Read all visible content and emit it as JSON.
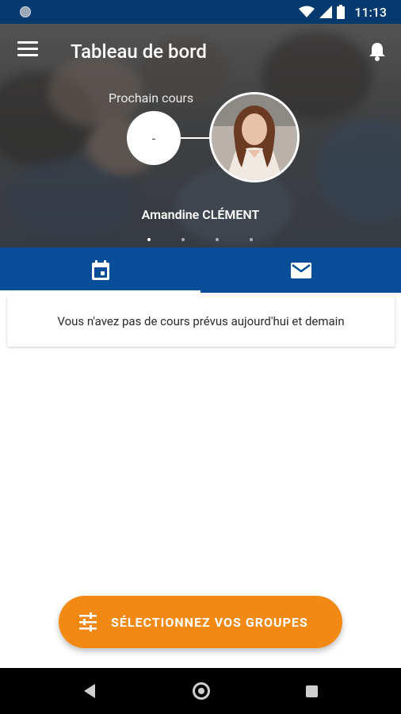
{
  "status_bar": {
    "time": "11:13"
  },
  "header": {
    "title": "Tableau de bord",
    "next_course_label": "Prochain cours",
    "next_course_value": "-",
    "teacher_name": "Amandine CLÉMENT",
    "pager_count": 4,
    "pager_active": 1
  },
  "tabs": [
    {
      "icon": "calendar-icon",
      "active": true
    },
    {
      "icon": "mail-icon",
      "active": false
    }
  ],
  "content": {
    "empty_message": "Vous n'avez pas de cours prévus aujourd'hui et demain"
  },
  "fab": {
    "icon": "tune-icon",
    "label": "SÉLECTIONNEZ VOS GROUPES"
  },
  "colors": {
    "status_bar": "#063a6f",
    "primary": "#064e97",
    "accent": "#f28913"
  }
}
